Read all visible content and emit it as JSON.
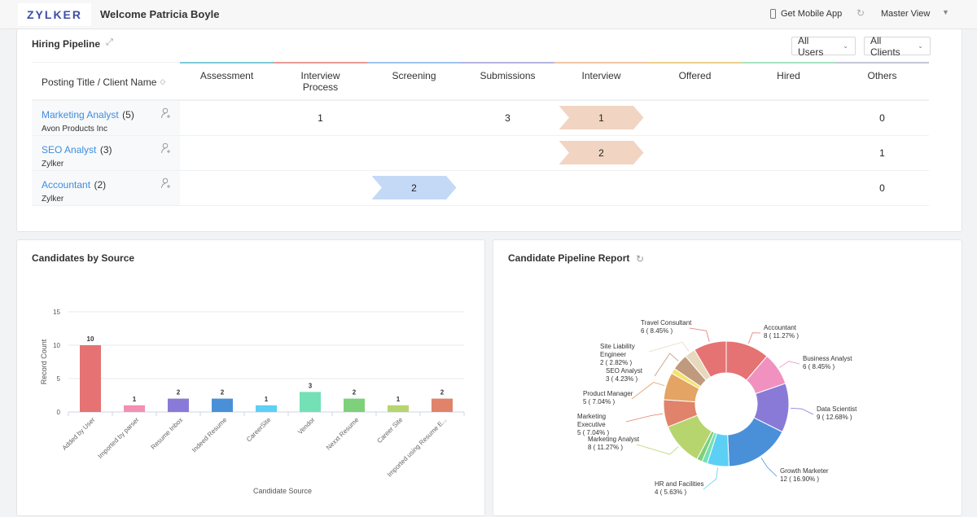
{
  "header": {
    "logo": "ZYLKER",
    "welcome": "Welcome Patricia Boyle",
    "mobile_app": "Get Mobile App",
    "view": "Master View"
  },
  "pipeline": {
    "title": "Hiring Pipeline",
    "filters": {
      "users": "All Users",
      "clients": "All Clients"
    },
    "first_col_header": "Posting Title / Client Name",
    "stages": [
      {
        "label": "Assessment",
        "color": "#7ecbd8"
      },
      {
        "label": "Interview Process",
        "color": "#e99a93"
      },
      {
        "label": "Screening",
        "color": "#9fc3f0"
      },
      {
        "label": "Submissions",
        "color": "#b5b3dc"
      },
      {
        "label": "Interview",
        "color": "#f0c5a8"
      },
      {
        "label": "Offered",
        "color": "#ead08a"
      },
      {
        "label": "Hired",
        "color": "#a9e3c2"
      },
      {
        "label": "Others",
        "color": "#c4c6d6"
      }
    ],
    "rows": [
      {
        "title": "Marketing Analyst",
        "count": "(5)",
        "client": "Avon Products Inc",
        "values": [
          "",
          "1",
          "",
          "3",
          "1",
          "",
          "",
          "0"
        ],
        "highlight": {
          "stage": 4,
          "color": "#f1d5c2"
        }
      },
      {
        "title": "SEO Analyst",
        "count": "(3)",
        "client": "Zylker",
        "values": [
          "",
          "",
          "",
          "",
          "2",
          "",
          "",
          "1"
        ],
        "highlight": {
          "stage": 4,
          "color": "#f1d5c2"
        }
      },
      {
        "title": "Accountant",
        "count": "(2)",
        "client": "Zylker",
        "values": [
          "",
          "",
          "2",
          "",
          "",
          "",
          "",
          "0"
        ],
        "highlight": {
          "stage": 2,
          "color": "#c3d9f6"
        }
      }
    ]
  },
  "chart_data": [
    {
      "type": "bar",
      "title": "Candidates by Source",
      "xlabel": "Candidate Source",
      "ylabel": "Record Count",
      "ylim": [
        0,
        15
      ],
      "yticks": [
        0,
        5,
        10,
        15
      ],
      "grid": true,
      "categories": [
        "Added by User",
        "Imported by parser",
        "Resume Inbox",
        "Indeed Resume",
        "CareerSite",
        "Vendor",
        "Nexxt Resume",
        "Career Site",
        "Imported using Resume E..."
      ],
      "values": [
        10,
        1,
        2,
        2,
        1,
        3,
        2,
        1,
        2
      ],
      "colors": [
        "#e57373",
        "#f48fb1",
        "#8a7ad8",
        "#4a90d9",
        "#5ccff5",
        "#73e1b5",
        "#7ed07a",
        "#b7d56e",
        "#e0836a"
      ]
    },
    {
      "type": "pie",
      "title": "Candidate Pipeline Report",
      "donut": true,
      "slices": [
        {
          "label": "Accountant",
          "value": 8,
          "percent": "11.27%",
          "color": "#e57373"
        },
        {
          "label": "Business Analyst",
          "value": 6,
          "percent": "8.45%",
          "color": "#f091bf"
        },
        {
          "label": "Data Scientist",
          "value": 9,
          "percent": "12.68%",
          "color": "#8a7ad8"
        },
        {
          "label": "Growth Marketer",
          "value": 12,
          "percent": "16.90%",
          "color": "#4a90d9"
        },
        {
          "label": "HR and Facilities",
          "value": 4,
          "percent": "5.63%",
          "color": "#5ccff5"
        },
        {
          "label": "",
          "value": 1,
          "percent": "1.41%",
          "color": "#73e1b5"
        },
        {
          "label": "",
          "value": 1,
          "percent": "1.41%",
          "color": "#7ed07a"
        },
        {
          "label": "Marketing Analyst",
          "value": 8,
          "percent": "11.27%",
          "color": "#b7d56e"
        },
        {
          "label": "Marketing Executive",
          "value": 5,
          "percent": "7.04%",
          "color": "#e0836a"
        },
        {
          "label": "Product Manager",
          "value": 5,
          "percent": "7.04%",
          "color": "#e3a464"
        },
        {
          "label": "",
          "value": 1,
          "percent": "1.41%",
          "color": "#f5e36c"
        },
        {
          "label": "SEO Analyst",
          "value": 3,
          "percent": "4.23%",
          "color": "#c09a7c"
        },
        {
          "label": "Site Liability Engineer",
          "value": 2,
          "percent": "2.82%",
          "color": "#e6d9bd"
        },
        {
          "label": "Travel Consultant",
          "value": 6,
          "percent": "8.45%",
          "color": "#e57373"
        }
      ]
    }
  ]
}
